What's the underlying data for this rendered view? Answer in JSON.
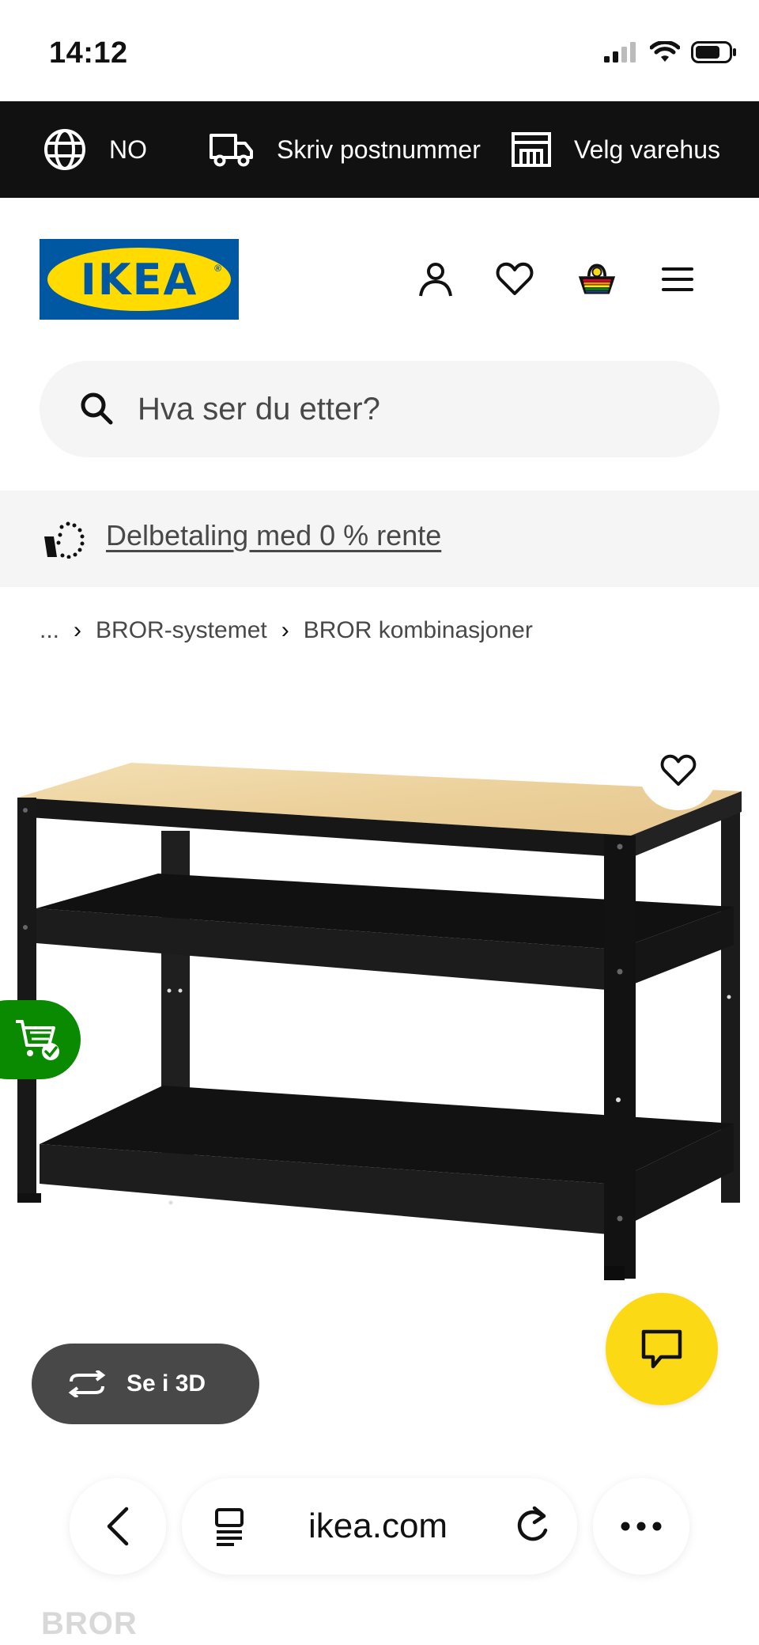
{
  "status_bar": {
    "time": "14:12"
  },
  "utility_bar": {
    "language": "NO",
    "postcode": "Skriv postnummer",
    "store": "Velg varehus"
  },
  "header": {
    "logo_text": "IKEA",
    "logo_colors": {
      "blue": "#0058a3",
      "yellow": "#ffdb00"
    }
  },
  "search": {
    "placeholder": "Hva ser du etter?"
  },
  "promo": {
    "link": "Delbetaling med 0 % rente"
  },
  "breadcrumb": {
    "ellipsis": "...",
    "items": [
      "BROR-systemet",
      "BROR kombinasjoner"
    ]
  },
  "product": {
    "view_3d": "Se i 3D",
    "name": "BROR"
  },
  "browser": {
    "url": "ikea.com"
  },
  "colors": {
    "chat": "#fbd914",
    "cart_tab": "#0a8a00",
    "utility_bg": "#111111"
  }
}
